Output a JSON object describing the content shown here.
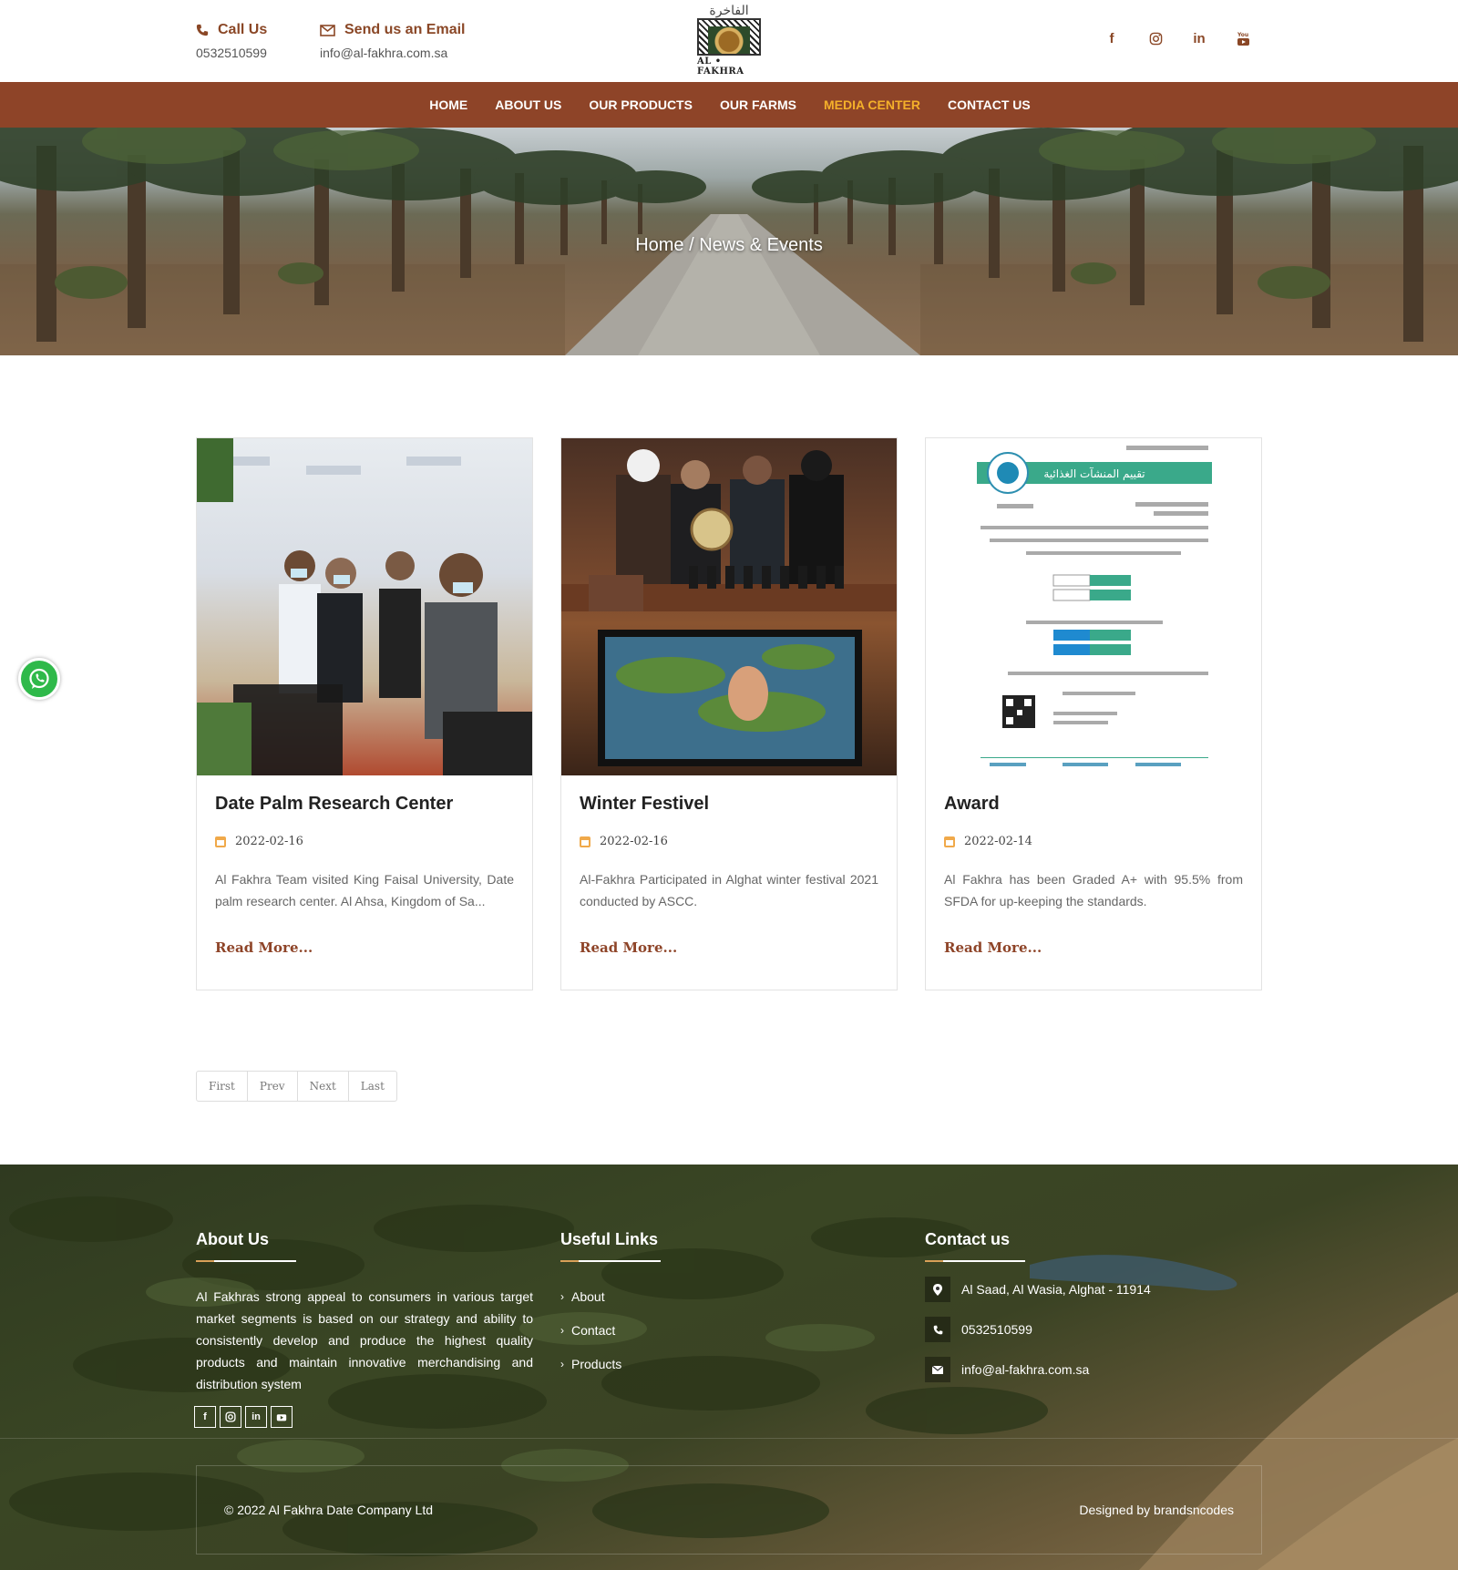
{
  "header": {
    "call": {
      "title": "Call Us",
      "value": "0532510599"
    },
    "email": {
      "title": "Send us an Email",
      "value": "info@al-fakhra.com.sa"
    },
    "logo": {
      "arabic": "الفاخرة",
      "english": "AL • FAKHRA"
    },
    "socials": [
      "facebook-icon",
      "instagram-icon",
      "linkedin-icon",
      "youtube-icon"
    ]
  },
  "nav": {
    "items": [
      "HOME",
      "ABOUT US",
      "OUR PRODUCTS",
      "OUR FARMS",
      "MEDIA CENTER",
      "CONTACT US"
    ],
    "active": "MEDIA CENTER"
  },
  "hero": {
    "breadcrumb": "Home / News & Events"
  },
  "cards": [
    {
      "title": "Date Palm Research Center",
      "date": "2022-02-16",
      "excerpt": "Al Fakhra Team visited King Faisal University, Date palm research center. Al Ahsa, Kingdom of Sa...",
      "read_more": "Read More..."
    },
    {
      "title": "Winter Festivel",
      "date": "2022-02-16",
      "excerpt": "Al-Fakhra Participated in Alghat winter festival 2021 conducted by ASCC.",
      "read_more": "Read More..."
    },
    {
      "title": "Award",
      "date": "2022-02-14",
      "excerpt": "Al Fakhra has been Graded A+ with 95.5% from SFDA for up-keeping the standards.",
      "read_more": "Read More...",
      "certificate_heading": "تقييم المنشآت الغذائية"
    }
  ],
  "pagination": [
    "First",
    "Prev",
    "Next",
    "Last"
  ],
  "footer": {
    "about": {
      "title": "About Us",
      "text": "Al Fakhras strong appeal to consumers in various target market segments is based on our strategy and ability to consistently develop and produce the highest quality products and maintain innovative merchandising and distribution system"
    },
    "links": {
      "title": "Useful Links",
      "items": [
        "About",
        "Contact",
        "Products"
      ]
    },
    "contact": {
      "title": "Contact us",
      "address": "Al Saad, Al Wasia, Alghat - 11914",
      "phone": "0532510599",
      "email": "info@al-fakhra.com.sa"
    },
    "copyright": "© 2022 Al Fakhra Date Company Ltd",
    "credit": "Designed by brandsncodes"
  },
  "colors": {
    "brand": "#8e4428",
    "nav_active": "#f4b02a",
    "whatsapp": "#2fb94a"
  }
}
